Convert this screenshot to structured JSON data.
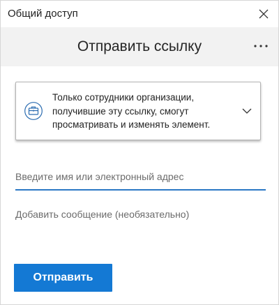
{
  "window": {
    "title": "Общий доступ",
    "close_icon": "close-icon"
  },
  "header": {
    "title": "Отправить ссылку",
    "more_icon": "more-options-icon"
  },
  "permission": {
    "icon": "briefcase-icon",
    "text": "Только сотрудники организации, получившие эту ссылку, смогут просматривать и изменять элемент.",
    "chevron_icon": "chevron-down-icon"
  },
  "recipient": {
    "placeholder": "Введите имя или электронный адрес",
    "value": ""
  },
  "message": {
    "placeholder": "Добавить сообщение (необязательно)",
    "value": ""
  },
  "actions": {
    "send_label": "Отправить"
  },
  "colors": {
    "accent": "#1479d4",
    "input_underline": "#2b78c5",
    "header_bg": "#f2f2f2"
  }
}
